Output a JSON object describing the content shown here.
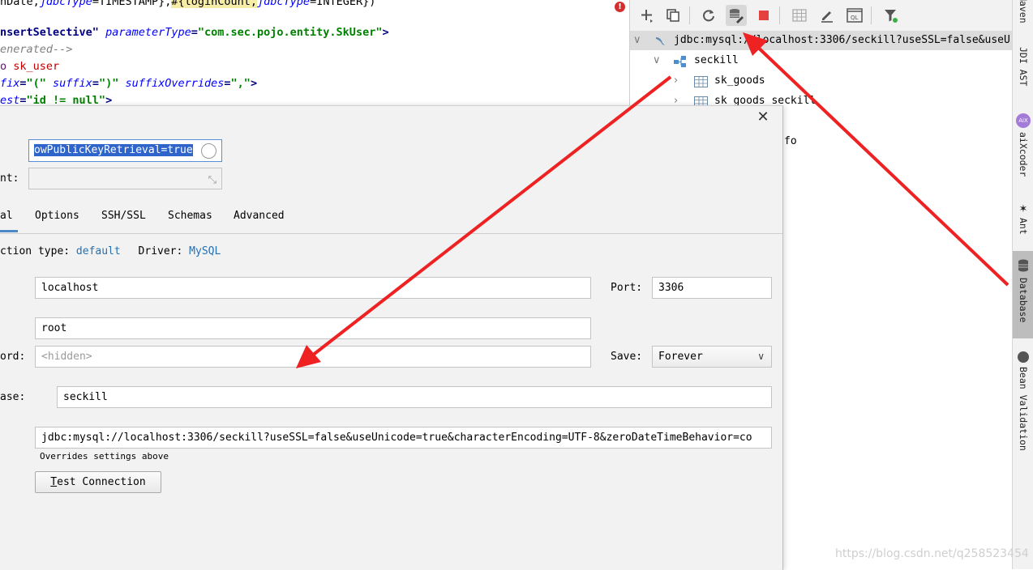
{
  "editor": {
    "line1": {
      "a": "nDate,",
      "b": "jdbcType",
      "c": "=TIMESTAMP},",
      "d": "#{loginCount,",
      "e": "jdbcType",
      "f": "=INTEGER})"
    },
    "line2": {
      "a": "nsertSelective\"",
      "b": "parameterType",
      "c": "=",
      "d": "\"com.sec.pojo.entity.SkUser\"",
      "e": ">"
    },
    "line3": {
      "a": "enerated-->"
    },
    "line4": {
      "a": "o ",
      "b": "sk_user"
    },
    "line5": {
      "a": "fix",
      "b": "=",
      "c": "\"(\"",
      "d": " suffix",
      "e": "=",
      "f": "\")\"",
      "g": " suffixOverrides",
      "h": "=",
      "i": "\",\"",
      "j": ">"
    },
    "line6": {
      "a": "est",
      "b": "=",
      "c": "\"id != null\"",
      "d": ">"
    }
  },
  "db_panel": {
    "connection_label": "jdbc:mysql://localhost:3306/seckill?useSSL=false&useU",
    "schema_label": "seckill",
    "tables": [
      "sk_goods",
      "sk_goods_seckill"
    ],
    "hidden_row_suffix": "fo"
  },
  "right_strip": {
    "tabs": [
      "Maven",
      "JDI AST",
      "aiXcoder",
      "Ant",
      "Database",
      "Bean Validation"
    ],
    "aix_badge": "AiX"
  },
  "dialog": {
    "url_field_value": "owPublicKeyRetrieval=true",
    "comment_label": "nt:",
    "tabs": [
      "al",
      "Options",
      "SSH/SSL",
      "Schemas",
      "Advanced"
    ],
    "connection_type_label": "ction type:",
    "connection_type_value": "default",
    "driver_label": "Driver:",
    "driver_value": "MySQL",
    "host_value": "localhost",
    "port_label": "Port:",
    "port_value": "3306",
    "user_value": "root",
    "password_label": "ord:",
    "password_placeholder": "<hidden>",
    "save_label": "Save:",
    "save_value": "Forever",
    "database_label": "ase:",
    "database_value": "seckill",
    "url_value": "jdbc:mysql://localhost:3306/seckill?useSSL=false&useUnicode=true&characterEncoding=UTF-8&zeroDateTimeBehavior=co",
    "url_hint": "Overrides settings above",
    "test_button_mnemonic": "T",
    "test_button_rest": "est Connection"
  },
  "watermark": "https://blog.csdn.net/q258523454",
  "colors": {
    "annotation_arrow": "#ee2222",
    "link": "#2470b3",
    "selection": "#2f65ca"
  }
}
